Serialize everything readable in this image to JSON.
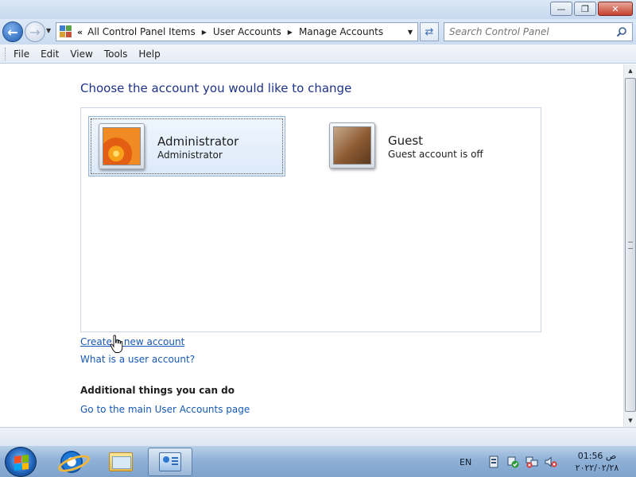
{
  "window": {
    "minimize_label": "—",
    "maximize_label": "❐",
    "close_label": "✕"
  },
  "address_bar": {
    "chevron": "«",
    "breadcrumbs": [
      "All Control Panel Items",
      "User Accounts",
      "Manage Accounts"
    ],
    "search_placeholder": "Search Control Panel"
  },
  "menu": [
    "File",
    "Edit",
    "View",
    "Tools",
    "Help"
  ],
  "main": {
    "heading": "Choose the account you would like to change",
    "accounts": [
      {
        "name": "Administrator",
        "subtitle": "Administrator",
        "selected": true
      },
      {
        "name": "Guest",
        "subtitle": "Guest account is off",
        "selected": false
      }
    ],
    "links": {
      "create_account": "Create a new account",
      "what_is_account": "What is a user account?"
    },
    "additional_heading": "Additional things you can do",
    "additional_links": [
      "Go to the main User Accounts page"
    ]
  },
  "taskbar": {
    "language": "EN",
    "time": "01:56 ص",
    "date": "٢٠٢٢/٠٢/٢٨"
  },
  "colors": {
    "link": "#1558b8",
    "heading": "#1e3287",
    "selection": "#dbe9f9"
  }
}
